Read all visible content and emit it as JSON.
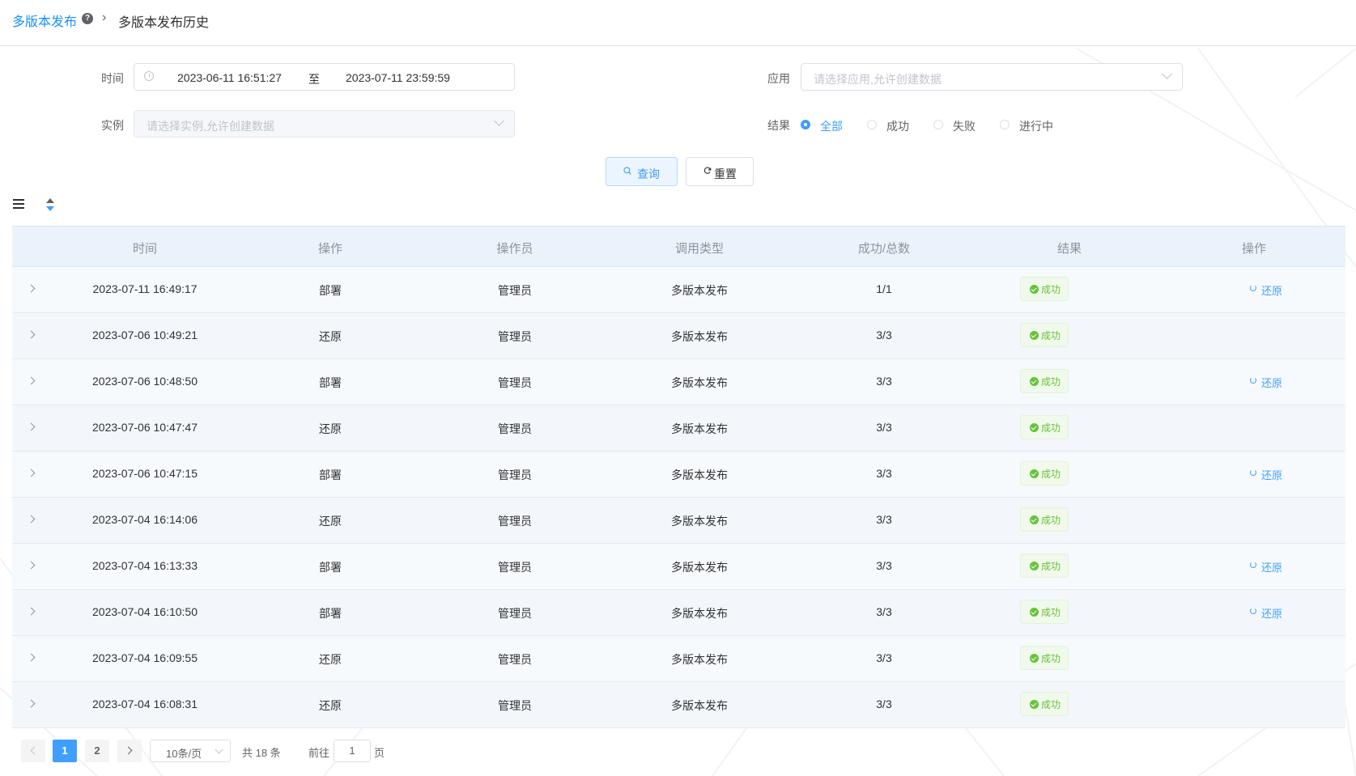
{
  "breadcrumb": {
    "root": "多版本发布",
    "current": "多版本发布历史"
  },
  "filters": {
    "time_label": "时间",
    "time_start": "2023-06-11 16:51:27",
    "time_sep": "至",
    "time_end": "2023-07-11 23:59:59",
    "app_label": "应用",
    "app_placeholder": "请选择应用,允许创建数据",
    "instance_label": "实例",
    "instance_placeholder": "请选择实例,允许创建数据",
    "result_label": "结果",
    "result_options": [
      "全部",
      "成功",
      "失败",
      "进行中"
    ],
    "result_selected": "全部"
  },
  "buttons": {
    "query": "查询",
    "reset": "重置"
  },
  "table": {
    "columns": [
      "时间",
      "操作",
      "操作员",
      "调用类型",
      "成功/总数",
      "结果",
      "操作"
    ],
    "restore_label": "还原",
    "rows": [
      {
        "time": "2023-07-11 16:49:17",
        "op": "部署",
        "operator": "管理员",
        "type": "多版本发布",
        "ratio": "1/1",
        "result": "成功",
        "restore": true
      },
      {
        "time": "2023-07-06 10:49:21",
        "op": "还原",
        "operator": "管理员",
        "type": "多版本发布",
        "ratio": "3/3",
        "result": "成功",
        "restore": false
      },
      {
        "time": "2023-07-06 10:48:50",
        "op": "部署",
        "operator": "管理员",
        "type": "多版本发布",
        "ratio": "3/3",
        "result": "成功",
        "restore": true
      },
      {
        "time": "2023-07-06 10:47:47",
        "op": "还原",
        "operator": "管理员",
        "type": "多版本发布",
        "ratio": "3/3",
        "result": "成功",
        "restore": false
      },
      {
        "time": "2023-07-06 10:47:15",
        "op": "部署",
        "operator": "管理员",
        "type": "多版本发布",
        "ratio": "3/3",
        "result": "成功",
        "restore": true
      },
      {
        "time": "2023-07-04 16:14:06",
        "op": "还原",
        "operator": "管理员",
        "type": "多版本发布",
        "ratio": "3/3",
        "result": "成功",
        "restore": false
      },
      {
        "time": "2023-07-04 16:13:33",
        "op": "部署",
        "operator": "管理员",
        "type": "多版本发布",
        "ratio": "3/3",
        "result": "成功",
        "restore": true
      },
      {
        "time": "2023-07-04 16:10:50",
        "op": "部署",
        "operator": "管理员",
        "type": "多版本发布",
        "ratio": "3/3",
        "result": "成功",
        "restore": true
      },
      {
        "time": "2023-07-04 16:09:55",
        "op": "还原",
        "operator": "管理员",
        "type": "多版本发布",
        "ratio": "3/3",
        "result": "成功",
        "restore": false
      },
      {
        "time": "2023-07-04 16:08:31",
        "op": "还原",
        "operator": "管理员",
        "type": "多版本发布",
        "ratio": "3/3",
        "result": "成功",
        "restore": false
      }
    ]
  },
  "pagination": {
    "pages": [
      "1",
      "2"
    ],
    "current_page": "1",
    "page_size": "10条/页",
    "total_text": "共 18 条",
    "goto_label": "前往",
    "goto_value": "1",
    "page_unit": "页"
  },
  "colors": {
    "primary": "#409eff",
    "success": "#67c23a",
    "breadcrumb_link": "#1890ff"
  }
}
